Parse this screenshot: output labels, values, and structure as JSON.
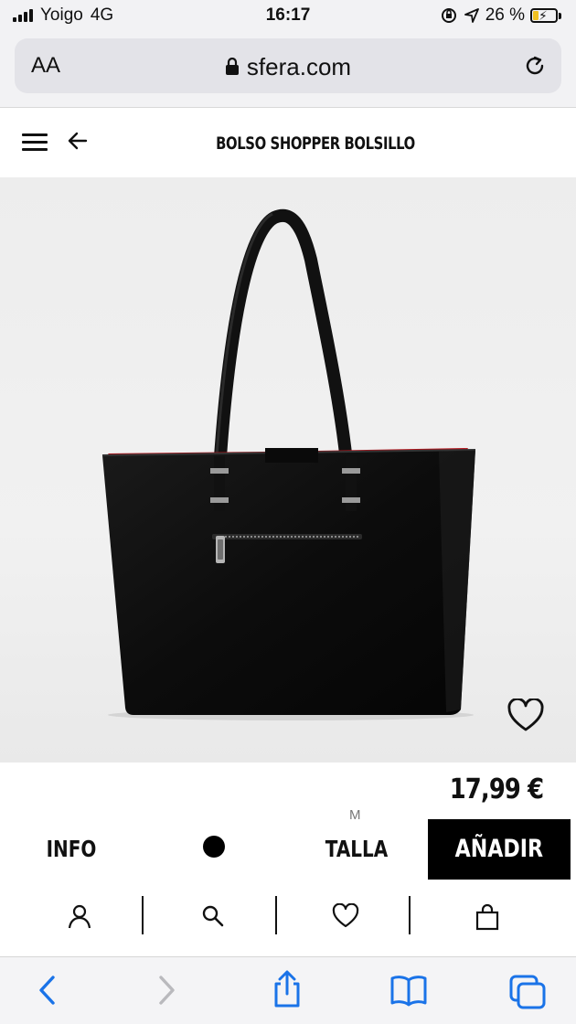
{
  "status_bar": {
    "carrier": "Yoigo",
    "network": "4G",
    "time": "16:17",
    "battery_percent": "26 %",
    "battery_level": 0.26
  },
  "browser": {
    "text_size_label": "AA",
    "url": "sfera.com",
    "icons": [
      "lock-icon",
      "reload-icon",
      "back-icon",
      "forward-icon",
      "share-icon",
      "bookmarks-icon",
      "tabs-icon"
    ]
  },
  "header": {
    "title": "BOLSO SHOPPER BOLSILLO",
    "icons": [
      "menu-icon",
      "back-arrow-icon"
    ]
  },
  "product": {
    "price": "17,99 €",
    "selected_size": "M",
    "info_label": "INFO",
    "size_label": "TALLA",
    "add_label": "AÑADIR",
    "selected_color": "#000000"
  },
  "site_nav": {
    "icons": [
      "account-icon",
      "search-icon",
      "wishlist-icon",
      "cart-icon"
    ]
  },
  "colors": {
    "accent": "#000000",
    "lining_red": "#b3141c",
    "ios_blue": "#1a73e8"
  }
}
